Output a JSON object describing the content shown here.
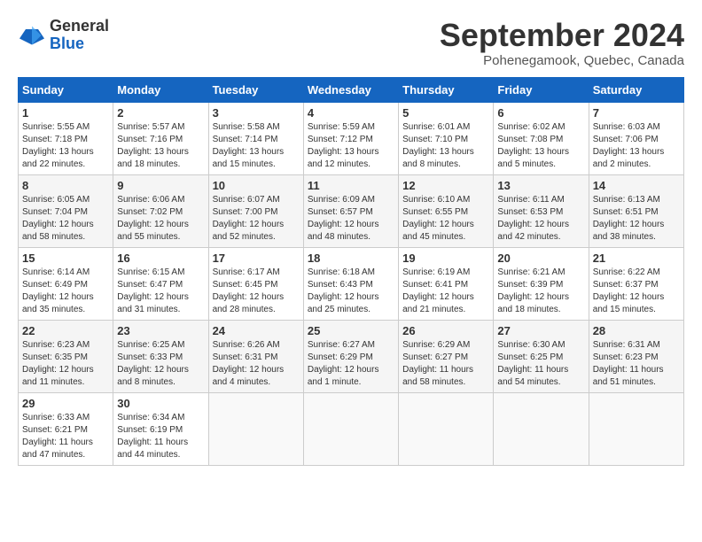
{
  "logo": {
    "general": "General",
    "blue": "Blue"
  },
  "title": "September 2024",
  "subtitle": "Pohenegamook, Quebec, Canada",
  "days_of_week": [
    "Sunday",
    "Monday",
    "Tuesday",
    "Wednesday",
    "Thursday",
    "Friday",
    "Saturday"
  ],
  "weeks": [
    [
      {
        "day": "1",
        "info": "Sunrise: 5:55 AM\nSunset: 7:18 PM\nDaylight: 13 hours\nand 22 minutes."
      },
      {
        "day": "2",
        "info": "Sunrise: 5:57 AM\nSunset: 7:16 PM\nDaylight: 13 hours\nand 18 minutes."
      },
      {
        "day": "3",
        "info": "Sunrise: 5:58 AM\nSunset: 7:14 PM\nDaylight: 13 hours\nand 15 minutes."
      },
      {
        "day": "4",
        "info": "Sunrise: 5:59 AM\nSunset: 7:12 PM\nDaylight: 13 hours\nand 12 minutes."
      },
      {
        "day": "5",
        "info": "Sunrise: 6:01 AM\nSunset: 7:10 PM\nDaylight: 13 hours\nand 8 minutes."
      },
      {
        "day": "6",
        "info": "Sunrise: 6:02 AM\nSunset: 7:08 PM\nDaylight: 13 hours\nand 5 minutes."
      },
      {
        "day": "7",
        "info": "Sunrise: 6:03 AM\nSunset: 7:06 PM\nDaylight: 13 hours\nand 2 minutes."
      }
    ],
    [
      {
        "day": "8",
        "info": "Sunrise: 6:05 AM\nSunset: 7:04 PM\nDaylight: 12 hours\nand 58 minutes."
      },
      {
        "day": "9",
        "info": "Sunrise: 6:06 AM\nSunset: 7:02 PM\nDaylight: 12 hours\nand 55 minutes."
      },
      {
        "day": "10",
        "info": "Sunrise: 6:07 AM\nSunset: 7:00 PM\nDaylight: 12 hours\nand 52 minutes."
      },
      {
        "day": "11",
        "info": "Sunrise: 6:09 AM\nSunset: 6:57 PM\nDaylight: 12 hours\nand 48 minutes."
      },
      {
        "day": "12",
        "info": "Sunrise: 6:10 AM\nSunset: 6:55 PM\nDaylight: 12 hours\nand 45 minutes."
      },
      {
        "day": "13",
        "info": "Sunrise: 6:11 AM\nSunset: 6:53 PM\nDaylight: 12 hours\nand 42 minutes."
      },
      {
        "day": "14",
        "info": "Sunrise: 6:13 AM\nSunset: 6:51 PM\nDaylight: 12 hours\nand 38 minutes."
      }
    ],
    [
      {
        "day": "15",
        "info": "Sunrise: 6:14 AM\nSunset: 6:49 PM\nDaylight: 12 hours\nand 35 minutes."
      },
      {
        "day": "16",
        "info": "Sunrise: 6:15 AM\nSunset: 6:47 PM\nDaylight: 12 hours\nand 31 minutes."
      },
      {
        "day": "17",
        "info": "Sunrise: 6:17 AM\nSunset: 6:45 PM\nDaylight: 12 hours\nand 28 minutes."
      },
      {
        "day": "18",
        "info": "Sunrise: 6:18 AM\nSunset: 6:43 PM\nDaylight: 12 hours\nand 25 minutes."
      },
      {
        "day": "19",
        "info": "Sunrise: 6:19 AM\nSunset: 6:41 PM\nDaylight: 12 hours\nand 21 minutes."
      },
      {
        "day": "20",
        "info": "Sunrise: 6:21 AM\nSunset: 6:39 PM\nDaylight: 12 hours\nand 18 minutes."
      },
      {
        "day": "21",
        "info": "Sunrise: 6:22 AM\nSunset: 6:37 PM\nDaylight: 12 hours\nand 15 minutes."
      }
    ],
    [
      {
        "day": "22",
        "info": "Sunrise: 6:23 AM\nSunset: 6:35 PM\nDaylight: 12 hours\nand 11 minutes."
      },
      {
        "day": "23",
        "info": "Sunrise: 6:25 AM\nSunset: 6:33 PM\nDaylight: 12 hours\nand 8 minutes."
      },
      {
        "day": "24",
        "info": "Sunrise: 6:26 AM\nSunset: 6:31 PM\nDaylight: 12 hours\nand 4 minutes."
      },
      {
        "day": "25",
        "info": "Sunrise: 6:27 AM\nSunset: 6:29 PM\nDaylight: 12 hours\nand 1 minute."
      },
      {
        "day": "26",
        "info": "Sunrise: 6:29 AM\nSunset: 6:27 PM\nDaylight: 11 hours\nand 58 minutes."
      },
      {
        "day": "27",
        "info": "Sunrise: 6:30 AM\nSunset: 6:25 PM\nDaylight: 11 hours\nand 54 minutes."
      },
      {
        "day": "28",
        "info": "Sunrise: 6:31 AM\nSunset: 6:23 PM\nDaylight: 11 hours\nand 51 minutes."
      }
    ],
    [
      {
        "day": "29",
        "info": "Sunrise: 6:33 AM\nSunset: 6:21 PM\nDaylight: 11 hours\nand 47 minutes."
      },
      {
        "day": "30",
        "info": "Sunrise: 6:34 AM\nSunset: 6:19 PM\nDaylight: 11 hours\nand 44 minutes."
      },
      {
        "day": "",
        "info": ""
      },
      {
        "day": "",
        "info": ""
      },
      {
        "day": "",
        "info": ""
      },
      {
        "day": "",
        "info": ""
      },
      {
        "day": "",
        "info": ""
      }
    ]
  ]
}
